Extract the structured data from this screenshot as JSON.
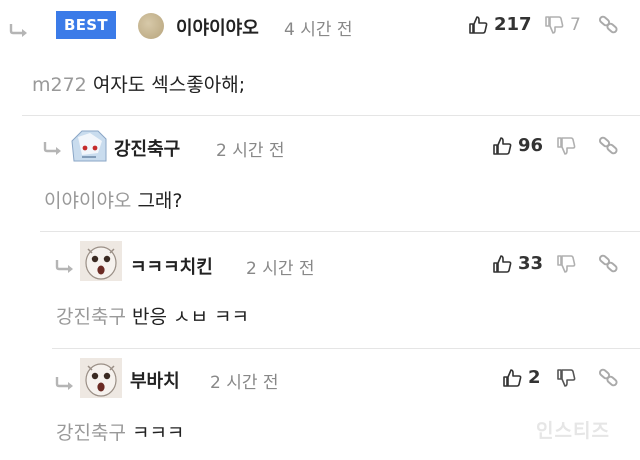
{
  "comments": [
    {
      "badge": "BEST",
      "nickname": "이야이야오",
      "time": "4 시간 전",
      "likes": "217",
      "dislikes": "7",
      "mention": "m272",
      "text": "여자도 섹스좋아해;"
    },
    {
      "nickname": "강진축구",
      "time": "2 시간 전",
      "likes": "96",
      "mention": "이야이야오",
      "text": "그래?"
    },
    {
      "nickname": "ㅋㅋㅋ치킨",
      "time": "2 시간 전",
      "likes": "33",
      "mention": "강진축구",
      "text": "반응 ㅅㅂ ㅋㅋ"
    },
    {
      "nickname": "부바치",
      "time": "2 시간 전",
      "likes": "2",
      "mention": "강진축구",
      "text": "ㅋㅋㅋ"
    }
  ],
  "watermark": "인스티즈",
  "icons": {
    "reply": "reply-arrow-icon",
    "like": "thumbs-up-icon",
    "dislike": "thumbs-down-icon",
    "link": "link-icon"
  },
  "colors": {
    "best_badge": "#3b7be8",
    "mention": "#999999",
    "time": "#888888"
  }
}
